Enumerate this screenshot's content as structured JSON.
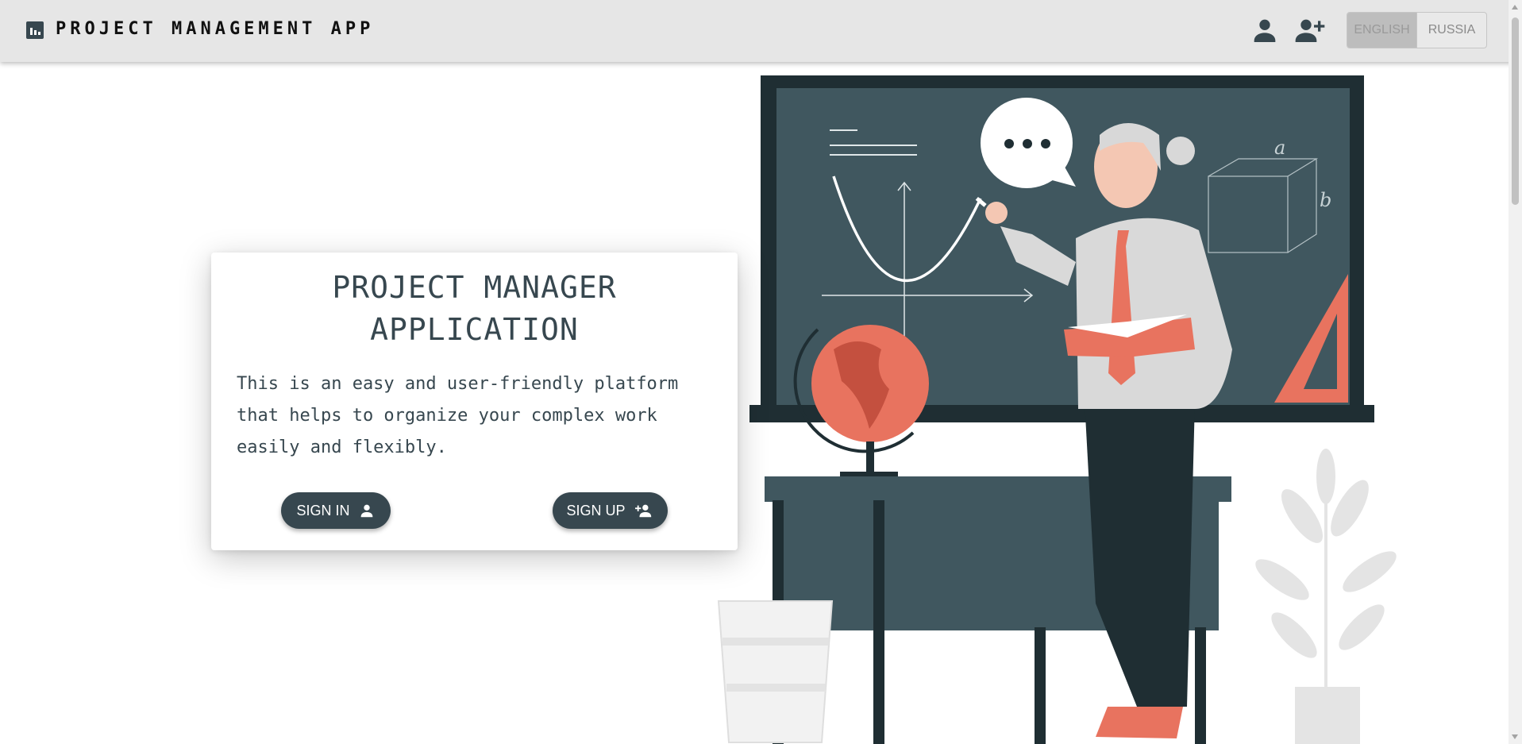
{
  "header": {
    "app_title": "PROJECT MANAGEMENT APP",
    "icons": [
      "logo-chart-icon",
      "person-icon",
      "person-add-icon"
    ],
    "languages": [
      {
        "label": "ENGLISH",
        "active": true
      },
      {
        "label": "RUSSIA",
        "active": false
      }
    ]
  },
  "card": {
    "title_line1": "PROJECT MANAGER",
    "title_line2": "APPLICATION",
    "description_line1": "This is an easy and user-friendly platform",
    "description_line2": "that helps to organize your complex work",
    "description_line3": "easily and flexibly.",
    "sign_in_label": "SIGN IN",
    "sign_up_label": "SIGN UP"
  },
  "illustration": {
    "chalkboard_letters": [
      "a",
      "b"
    ]
  },
  "colors": {
    "primary": "#37474f",
    "header_bg": "#e6e6e6",
    "accent": "#e8735f",
    "board": "#40575f",
    "board_frame": "#1f2e33"
  }
}
